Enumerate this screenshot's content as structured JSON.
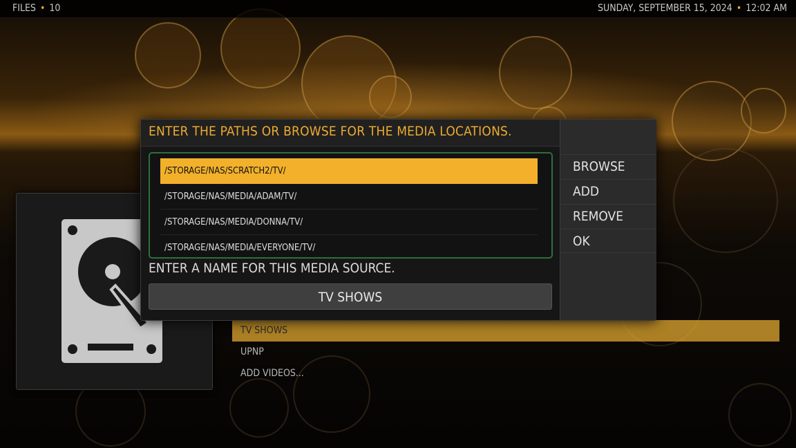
{
  "topbar": {
    "section": "FILES",
    "count": "10",
    "datetime": "SUNDAY, SEPTEMBER 15, 2024",
    "time": "12:02 AM"
  },
  "background_list": {
    "items": [
      "TV SHOWS",
      "UPNP",
      "ADD VIDEOS..."
    ],
    "selected_index": 0
  },
  "icon_panel": {
    "icon": "hard-drive-icon"
  },
  "dialog": {
    "paths_title": "ENTER THE PATHS OR BROWSE FOR THE MEDIA LOCATIONS.",
    "paths": [
      "/STORAGE/NAS/SCRATCH2/TV/",
      "/STORAGE/NAS/MEDIA/ADAM/TV/",
      "/STORAGE/NAS/MEDIA/DONNA/TV/",
      "/STORAGE/NAS/MEDIA/EVERYONE/TV/"
    ],
    "selected_path_index": 0,
    "name_label": "ENTER A NAME FOR THIS MEDIA SOURCE.",
    "name_value": "TV SHOWS",
    "buttons": [
      "BROWSE",
      "ADD",
      "REMOVE",
      "OK"
    ]
  },
  "colors": {
    "accent": "#f3b12b",
    "title_text": "#ecab2e",
    "paths_border": "#2e6e3e"
  }
}
